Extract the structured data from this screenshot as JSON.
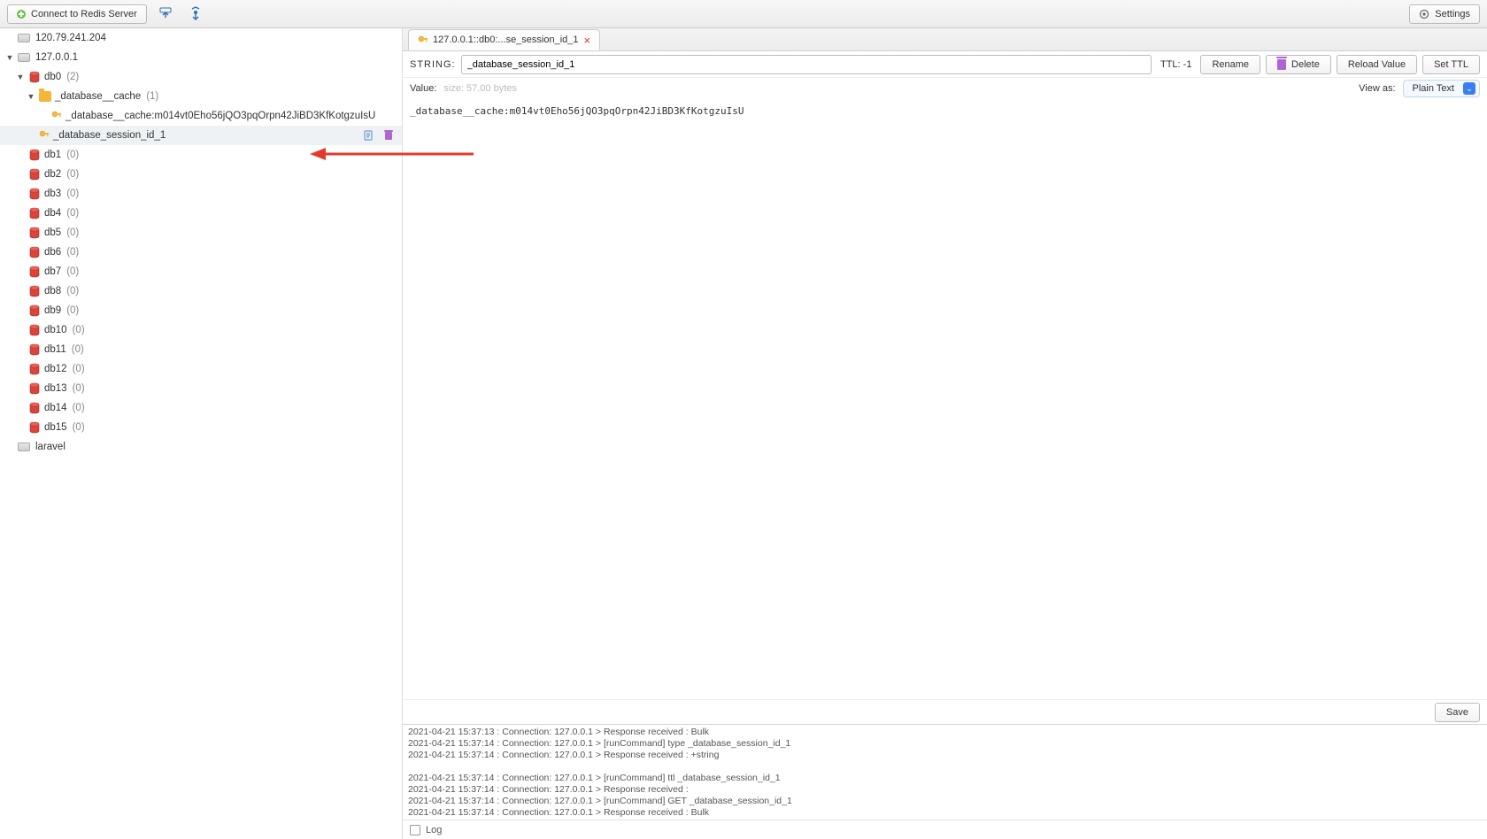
{
  "toolbar": {
    "connect_label": "Connect to Redis Server",
    "settings_label": "Settings"
  },
  "servers": [
    {
      "host": "120.79.241.204"
    },
    {
      "host": "127.0.0.1"
    },
    {
      "host": "laravel"
    }
  ],
  "server_expanded": {
    "db0": {
      "label": "db0",
      "count": "(2)",
      "folder": {
        "name": "_database__cache",
        "count": "(1)",
        "key": "_database__cache:m014vt0Eho56jQO3pqOrpn42JiBD3KfKotgzuIsU"
      },
      "selected_key": "_database_session_id_1"
    },
    "dbs_empty": [
      {
        "label": "db1",
        "count": "(0)"
      },
      {
        "label": "db2",
        "count": "(0)"
      },
      {
        "label": "db3",
        "count": "(0)"
      },
      {
        "label": "db4",
        "count": "(0)"
      },
      {
        "label": "db5",
        "count": "(0)"
      },
      {
        "label": "db6",
        "count": "(0)"
      },
      {
        "label": "db7",
        "count": "(0)"
      },
      {
        "label": "db8",
        "count": "(0)"
      },
      {
        "label": "db9",
        "count": "(0)"
      },
      {
        "label": "db10",
        "count": "(0)"
      },
      {
        "label": "db11",
        "count": "(0)"
      },
      {
        "label": "db12",
        "count": "(0)"
      },
      {
        "label": "db13",
        "count": "(0)"
      },
      {
        "label": "db14",
        "count": "(0)"
      },
      {
        "label": "db15",
        "count": "(0)"
      }
    ]
  },
  "tab": {
    "title": "127.0.0.1::db0:...se_session_id_1"
  },
  "key_editor": {
    "type_label": "STRING:",
    "key_name": "_database_session_id_1",
    "ttl_label": "TTL:",
    "ttl_value": "-1",
    "rename_label": "Rename",
    "delete_label": "Delete",
    "reload_label": "Reload Value",
    "setttl_label": "Set TTL",
    "value_label": "Value:",
    "value_meta": "size: 57.00 bytes",
    "viewas_label": "View as:",
    "viewas_value": "Plain Text",
    "value_text": "_database__cache:m014vt0Eho56jQO3pqOrpn42JiBD3KfKotgzuIsU",
    "save_label": "Save"
  },
  "log": {
    "lines": [
      "2021-04-21 15:37:13 : Connection: 127.0.0.1 > Response received : Bulk",
      "2021-04-21 15:37:14 : Connection: 127.0.0.1 > [runCommand] type _database_session_id_1",
      "2021-04-21 15:37:14 : Connection: 127.0.0.1 > Response received : +string",
      "",
      "2021-04-21 15:37:14 : Connection: 127.0.0.1 > [runCommand] ttl _database_session_id_1",
      "2021-04-21 15:37:14 : Connection: 127.0.0.1 > Response received :",
      "2021-04-21 15:37:14 : Connection: 127.0.0.1 > [runCommand] GET _database_session_id_1",
      "2021-04-21 15:37:14 : Connection: 127.0.0.1 > Response received : Bulk"
    ],
    "label": "Log"
  }
}
